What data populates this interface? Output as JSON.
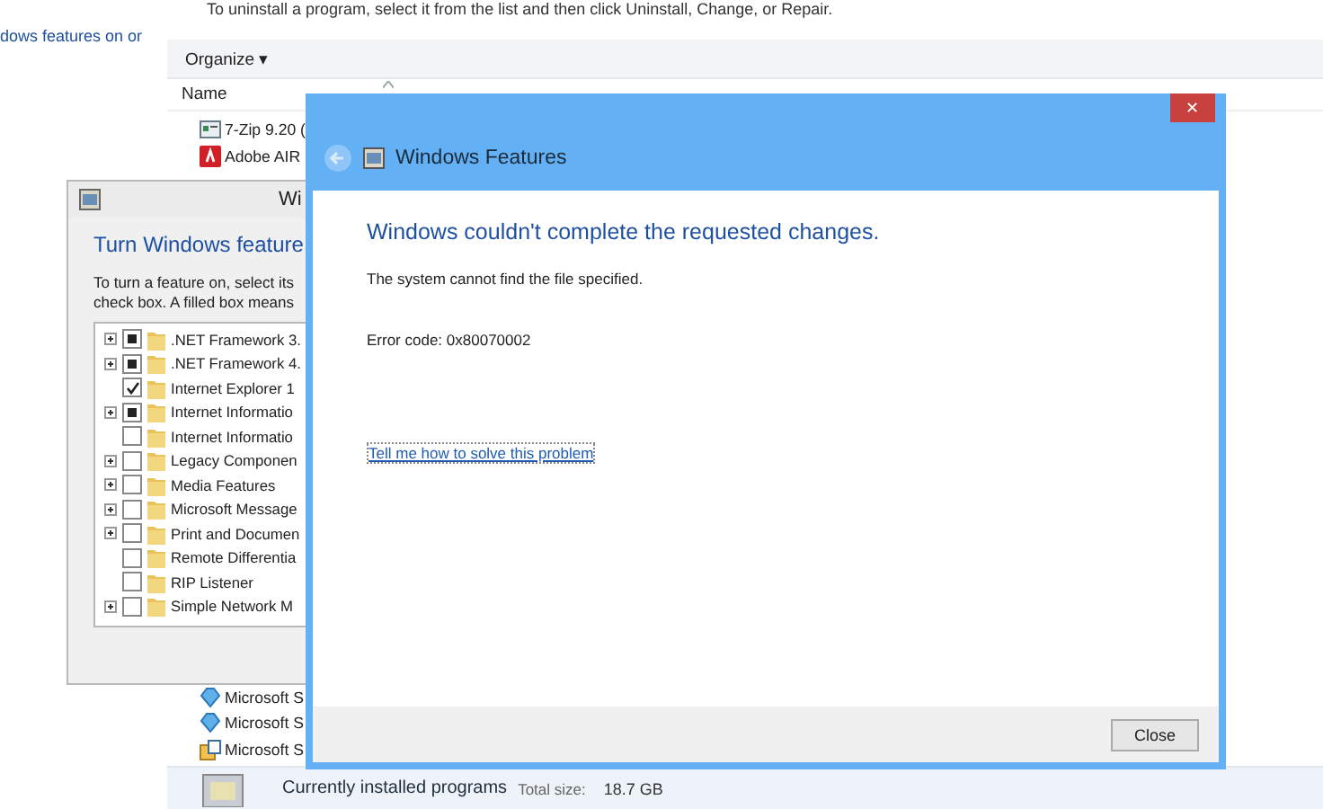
{
  "explorer": {
    "instruction": "To uninstall a program, select it from the list and then click Uninstall, Change, or Repair.",
    "sidebar_link": "dows features on or",
    "toolbar": {
      "organize": "Organize",
      "organize_caret": "▾"
    },
    "columns": [
      {
        "label": "Name"
      }
    ],
    "programs_top": [
      {
        "name": "7-Zip 9.20 (",
        "kind": "archive"
      },
      {
        "name": "Adobe AIR",
        "kind": "adobe"
      }
    ],
    "programs_bottom": [
      {
        "name": "Microsoft S",
        "kind": "installer"
      },
      {
        "name": "Microsoft S",
        "kind": "installer"
      },
      {
        "name": "Microsoft S",
        "kind": "package"
      }
    ],
    "status": {
      "title": "Currently installed programs",
      "size_label": "Total size:",
      "size_value": "18.7 GB"
    }
  },
  "features_window": {
    "title": "Wi",
    "heading": "Turn Windows feature",
    "description": [
      "To turn a feature on, select its",
      "check box. A filled box means"
    ],
    "features": [
      {
        "label": ".NET Framework 3.",
        "expandable": true,
        "checked": true,
        "partial": true
      },
      {
        "label": ".NET Framework 4.",
        "expandable": true,
        "checked": true,
        "partial": true
      },
      {
        "label": "Internet Explorer 1",
        "expandable": false,
        "checked": true,
        "partial": false
      },
      {
        "label": "Internet Informatio",
        "expandable": true,
        "checked": true,
        "partial": true
      },
      {
        "label": "Internet Informatio",
        "expandable": false,
        "checked": false,
        "partial": false
      },
      {
        "label": "Legacy Componen",
        "expandable": true,
        "checked": false,
        "partial": false
      },
      {
        "label": "Media Features",
        "expandable": true,
        "checked": false,
        "partial": false
      },
      {
        "label": "Microsoft Message",
        "expandable": true,
        "checked": false,
        "partial": false
      },
      {
        "label": "Print and Documen",
        "expandable": true,
        "checked": false,
        "partial": false
      },
      {
        "label": "Remote Differentia",
        "expandable": false,
        "checked": false,
        "partial": false
      },
      {
        "label": "RIP Listener",
        "expandable": false,
        "checked": false,
        "partial": false
      },
      {
        "label": "Simple Network M",
        "expandable": true,
        "checked": false,
        "partial": false
      }
    ]
  },
  "error_dialog": {
    "title": "Windows Features",
    "close": "✕",
    "heading": "Windows couldn't complete the requested changes.",
    "message": "The system cannot find the file specified.",
    "error_code": "Error code: 0x80070002",
    "link": "Tell me how to solve this problem",
    "button": "Close"
  }
}
